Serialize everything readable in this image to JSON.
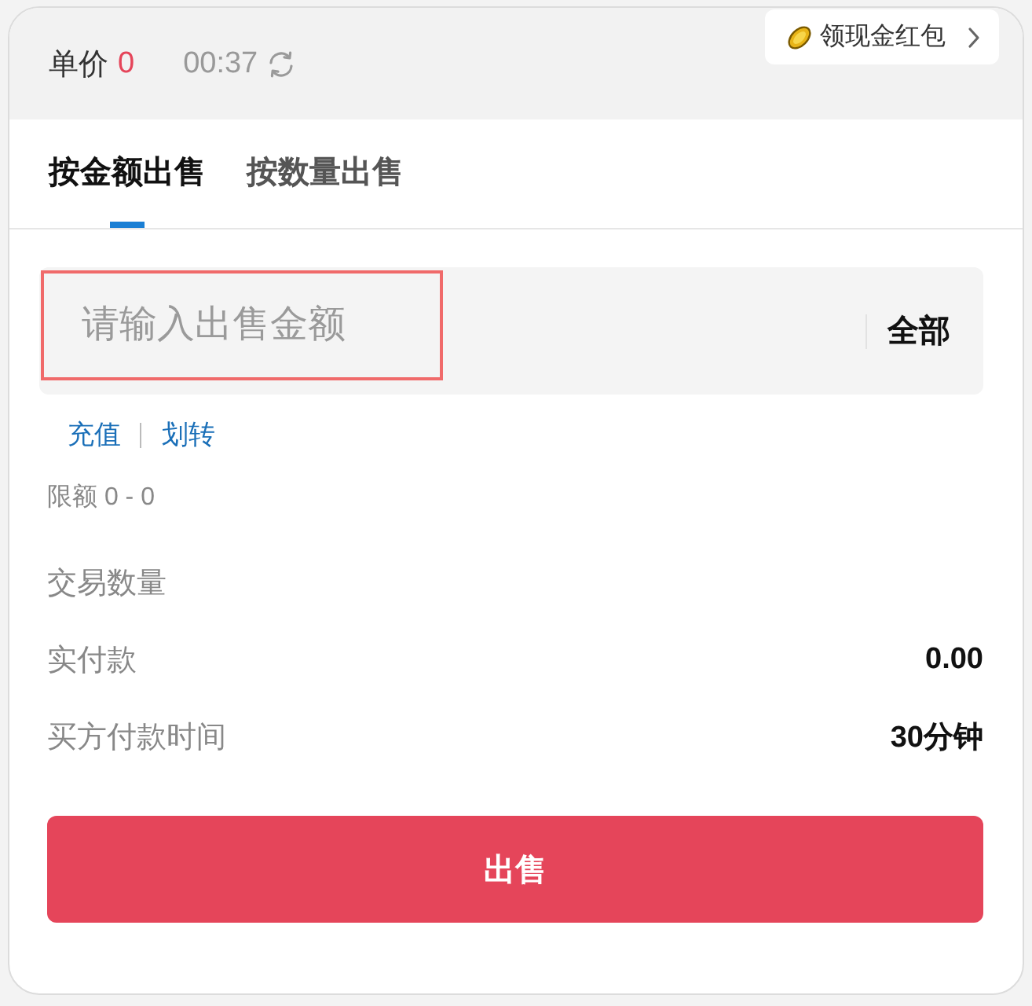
{
  "header": {
    "price_label": "单价",
    "price_value": "0",
    "timer": "00:37",
    "promo": {
      "label": "领现金红包"
    }
  },
  "tabs": [
    {
      "label": "按金额出售",
      "selected": true
    },
    {
      "label": "按数量出售",
      "selected": false
    }
  ],
  "amount_field": {
    "placeholder": "请输入出售金额",
    "highlighted": true,
    "all_button": "全部"
  },
  "links": [
    "充值",
    "划转"
  ],
  "limit": "限额 0 - 0",
  "details": [
    {
      "label": "交易数量"
    },
    {
      "label": "实付款",
      "value": "0.00"
    },
    {
      "label": "买方付款时间",
      "value": "30分钟"
    }
  ],
  "submit_button": "出售"
}
